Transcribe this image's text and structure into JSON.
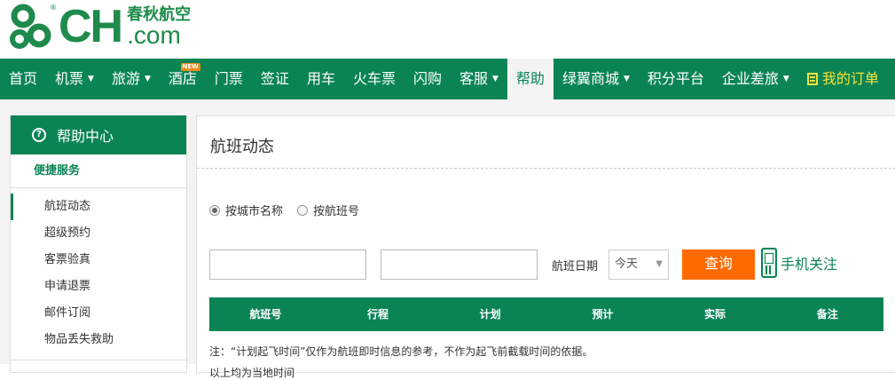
{
  "brand": {
    "logo_letters": "CH",
    "logo_chinese": "春秋航空",
    "logo_domain": ".com",
    "primary_color": "#0b8454",
    "accent_color": "#ff6a00"
  },
  "nav": {
    "items": [
      {
        "label": "首页",
        "caret": false
      },
      {
        "label": "机票",
        "caret": true
      },
      {
        "label": "旅游",
        "caret": true
      },
      {
        "label": "酒店",
        "caret": false,
        "badge": "NEW"
      },
      {
        "label": "门票",
        "caret": false
      },
      {
        "label": "签证",
        "caret": false
      },
      {
        "label": "用车",
        "caret": false
      },
      {
        "label": "火车票",
        "caret": false
      },
      {
        "label": "闪购",
        "caret": false
      },
      {
        "label": "客服",
        "caret": true
      },
      {
        "label": "帮助",
        "caret": false,
        "active": true
      },
      {
        "label": "绿翼商城",
        "caret": true
      },
      {
        "label": "积分平台",
        "caret": false
      },
      {
        "label": "企业差旅",
        "caret": true
      }
    ],
    "orders_label": "我的订单"
  },
  "sidebar": {
    "title": "帮助中心",
    "section": "便捷服务",
    "items": [
      {
        "label": "航班动态",
        "active": true
      },
      {
        "label": "超级预约"
      },
      {
        "label": "客票验真"
      },
      {
        "label": "申请退票"
      },
      {
        "label": "邮件订阅"
      },
      {
        "label": "物品丢失救助"
      }
    ]
  },
  "main": {
    "title": "航班动态",
    "radio_city": "按城市名称",
    "radio_flight": "按航班号",
    "date_label": "航班日期",
    "date_value": "今天",
    "query_button": "查询",
    "mobile_follow": "手机关注",
    "table_headers": [
      "航班号",
      "行程",
      "计划",
      "预计",
      "实际",
      "备注"
    ],
    "note": "注：“计划起飞时间”仅作为航班即时信息的参考，不作为起飞前截载时间的依据。",
    "note2": "以上均为当地时间"
  }
}
